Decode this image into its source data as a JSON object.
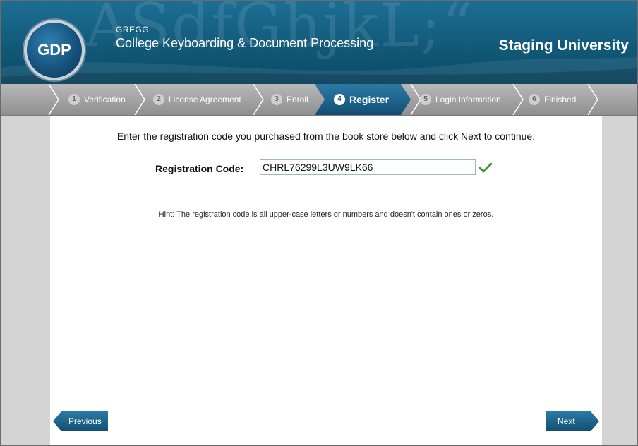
{
  "header": {
    "logo_text": "GDP",
    "brand_small": "GREGG",
    "brand_title": "College Keyboarding & Document Processing",
    "school": "Staging University",
    "watermark": "ASdfGhjkL;“"
  },
  "steps": [
    {
      "num": "1",
      "label": "Verification"
    },
    {
      "num": "2",
      "label": "License Agreement"
    },
    {
      "num": "3",
      "label": "Enroll"
    },
    {
      "num": "4",
      "label": "Register"
    },
    {
      "num": "5",
      "label": "Login Information"
    },
    {
      "num": "6",
      "label": "Finished"
    }
  ],
  "active_step": 4,
  "main": {
    "intro": "Enter the registration code you purchased from the book store below and click Next to continue.",
    "reg_label": "Registration Code:",
    "reg_value": "CHRL76299L3UW9LK66",
    "hint": "Hint: The registration code is all upper-case letters or numbers and doesn't contain ones or zeros."
  },
  "nav": {
    "previous": "Previous",
    "next": "Next"
  },
  "colors": {
    "header_blue": "#115877",
    "accent_blue": "#1a5f84",
    "valid_green": "#3a9a2a"
  }
}
